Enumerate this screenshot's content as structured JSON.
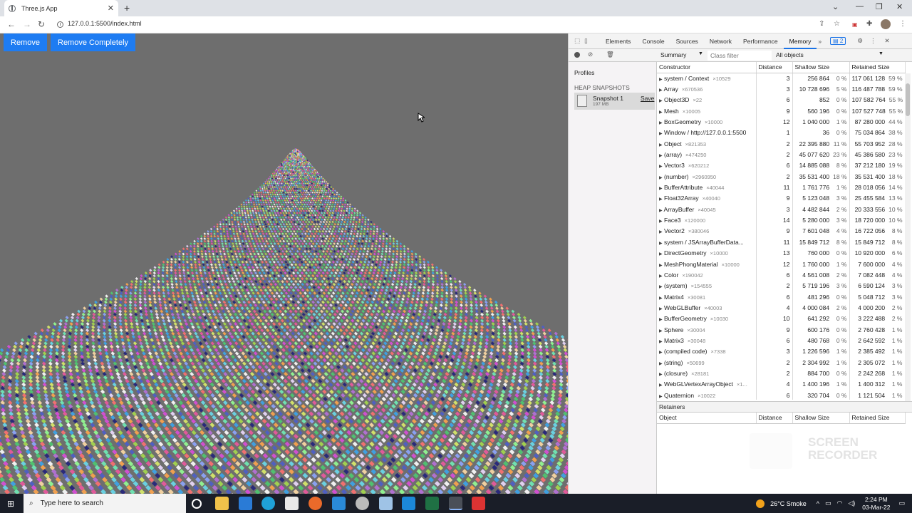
{
  "browser": {
    "tab_title": "Three.js App",
    "url": "127.0.0.1:5500/index.html"
  },
  "app": {
    "remove_label": "Remove",
    "remove_completely_label": "Remove Completely"
  },
  "devtools": {
    "tabs": [
      "Elements",
      "Console",
      "Sources",
      "Network",
      "Performance",
      "Memory"
    ],
    "active_tab": "Memory",
    "issues_count": "2",
    "view_select": "Summary",
    "class_filter_placeholder": "Class filter",
    "objects_select": "All objects",
    "profiles_label": "Profiles",
    "heap_snapshots_label": "HEAP SNAPSHOTS",
    "snapshot_name": "Snapshot 1",
    "snapshot_size": "197 MB",
    "save_label": "Save",
    "columns": {
      "constructor": "Constructor",
      "distance": "Distance",
      "shallow": "Shallow Size",
      "retained": "Retained Size"
    },
    "rows": [
      [
        "system / Context",
        "×10529",
        "3",
        "256 864",
        "0 %",
        "117 061 128",
        "59 %"
      ],
      [
        "Array",
        "×670536",
        "3",
        "10 728 696",
        "5 %",
        "116 487 788",
        "59 %"
      ],
      [
        "Object3D",
        "×22",
        "6",
        "852",
        "0 %",
        "107 582 764",
        "55 %"
      ],
      [
        "Mesh",
        "×10005",
        "9",
        "560 196",
        "0 %",
        "107 527 748",
        "55 %"
      ],
      [
        "BoxGeometry",
        "×10000",
        "12",
        "1 040 000",
        "1 %",
        "87 280 000",
        "44 %"
      ],
      [
        "Window / http://127.0.0.1:5500",
        "",
        "1",
        "36",
        "0 %",
        "75 034 864",
        "38 %"
      ],
      [
        "Object",
        "×821353",
        "2",
        "22 395 880",
        "11 %",
        "55 703 952",
        "28 %"
      ],
      [
        "(array)",
        "×474250",
        "2",
        "45 077 620",
        "23 %",
        "45 386 580",
        "23 %"
      ],
      [
        "Vector3",
        "×620212",
        "6",
        "14 885 088",
        "8 %",
        "37 212 180",
        "19 %"
      ],
      [
        "(number)",
        "×2960950",
        "2",
        "35 531 400",
        "18 %",
        "35 531 400",
        "18 %"
      ],
      [
        "BufferAttribute",
        "×40044",
        "11",
        "1 761 776",
        "1 %",
        "28 018 056",
        "14 %"
      ],
      [
        "Float32Array",
        "×40040",
        "9",
        "5 123 048",
        "3 %",
        "25 455 584",
        "13 %"
      ],
      [
        "ArrayBuffer",
        "×40045",
        "3",
        "4 482 844",
        "2 %",
        "20 333 556",
        "10 %"
      ],
      [
        "Face3",
        "×120000",
        "14",
        "5 280 000",
        "3 %",
        "18 720 000",
        "10 %"
      ],
      [
        "Vector2",
        "×380046",
        "9",
        "7 601 048",
        "4 %",
        "16 722 056",
        "8 %"
      ],
      [
        "system / JSArrayBufferData...",
        "",
        "11",
        "15 849 712",
        "8 %",
        "15 849 712",
        "8 %"
      ],
      [
        "DirectGeometry",
        "×10000",
        "13",
        "760 000",
        "0 %",
        "10 920 000",
        "6 %"
      ],
      [
        "MeshPhongMaterial",
        "×10000",
        "12",
        "1 760 000",
        "1 %",
        "7 600 000",
        "4 %"
      ],
      [
        "Color",
        "×190042",
        "6",
        "4 561 008",
        "2 %",
        "7 082 448",
        "4 %"
      ],
      [
        "(system)",
        "×154555",
        "2",
        "5 719 196",
        "3 %",
        "6 590 124",
        "3 %"
      ],
      [
        "Matrix4",
        "×30081",
        "6",
        "481 296",
        "0 %",
        "5 048 712",
        "3 %"
      ],
      [
        "WebGLBuffer",
        "×40003",
        "4",
        "4 000 084",
        "2 %",
        "4 000 200",
        "2 %"
      ],
      [
        "BufferGeometry",
        "×10030",
        "10",
        "641 292",
        "0 %",
        "3 222 488",
        "2 %"
      ],
      [
        "Sphere",
        "×30004",
        "9",
        "600 176",
        "0 %",
        "2 760 428",
        "1 %"
      ],
      [
        "Matrix3",
        "×30048",
        "6",
        "480 768",
        "0 %",
        "2 642 592",
        "1 %"
      ],
      [
        "(compiled code)",
        "×7338",
        "3",
        "1 226 596",
        "1 %",
        "2 385 492",
        "1 %"
      ],
      [
        "(string)",
        "×50699",
        "2",
        "2 304 992",
        "1 %",
        "2 305 072",
        "1 %"
      ],
      [
        "(closure)",
        "×28181",
        "2",
        "884 700",
        "0 %",
        "2 242 268",
        "1 %"
      ],
      [
        "WebGLVertexArrayObject",
        "×1...",
        "4",
        "1 400 196",
        "1 %",
        "1 400 312",
        "1 %"
      ],
      [
        "Quaternion",
        "×10022",
        "6",
        "320 704",
        "0 %",
        "1 121 504",
        "1 %"
      ]
    ],
    "retainers_label": "Retainers",
    "retainer_columns": {
      "object": "Object",
      "distance": "Distance",
      "shallow": "Shallow Size",
      "retained": "Retained Size"
    }
  },
  "taskbar": {
    "search_placeholder": "Type here to search",
    "weather": "26°C  Smoke",
    "time": "2:24 PM",
    "date": "03-Mar-22"
  },
  "watermark": "SCREEN RECORDER"
}
